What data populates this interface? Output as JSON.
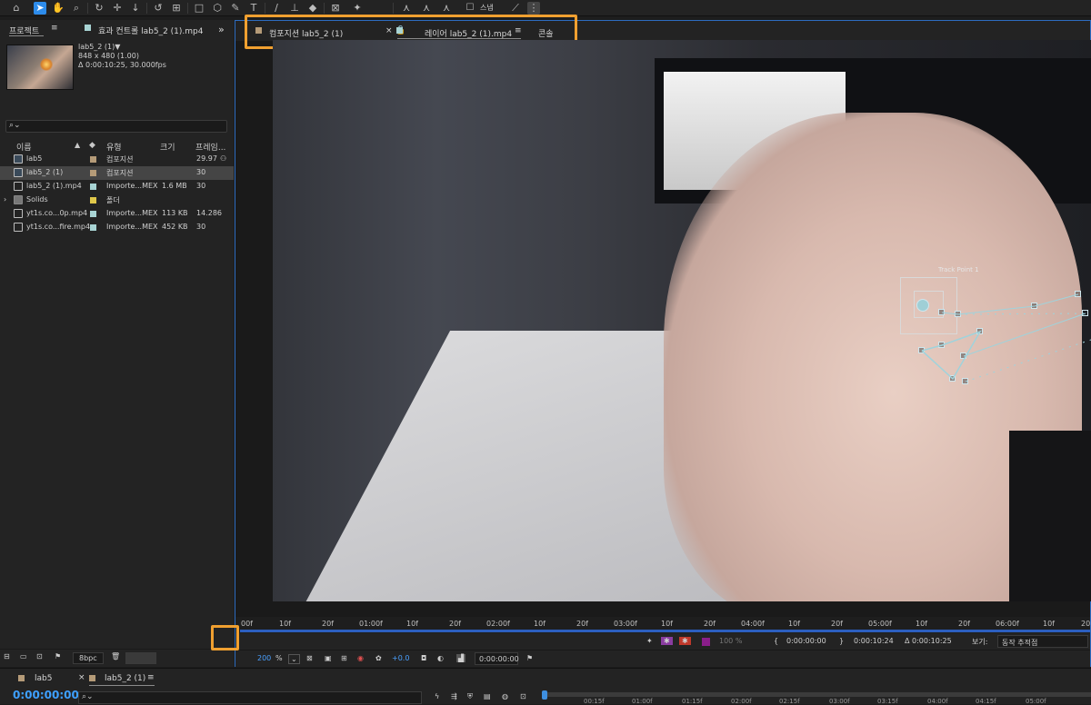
{
  "toolbar": {
    "snap_label": "스냅"
  },
  "project_panel": {
    "tab_project": "프로젝트",
    "tab_effects": "효과 컨트롤 lab5_2 (1).mp4",
    "item_name": "lab5_2 (1)▼",
    "item_dims": "848 x 480 (1.00)",
    "item_duration": "Δ 0:00:10:25, 30.000fps",
    "columns": {
      "name": "이름",
      "type": "유형",
      "size": "크기",
      "framerate": "프레임..."
    },
    "rows": [
      {
        "name": "lab5",
        "type": "컴포지션",
        "size": "",
        "fps": "29.97",
        "color": "#b59b78"
      },
      {
        "name": "lab5_2 (1)",
        "type": "컴포지션",
        "size": "",
        "fps": "30",
        "color": "#b59b78"
      },
      {
        "name": "lab5_2 (1).mp4",
        "type": "Importe...MEX",
        "size": "1.6 MB",
        "fps": "30",
        "color": "#a8d4d4"
      },
      {
        "name": "Solids",
        "type": "폴더",
        "size": "",
        "fps": "",
        "color": "#e0c84a"
      },
      {
        "name": "yt1s.co...0p.mp4",
        "type": "Importe...MEX",
        "size": "113 KB",
        "fps": "14.286",
        "color": "#a8d4d4"
      },
      {
        "name": "yt1s.co...fire.mp4",
        "type": "Importe...MEX",
        "size": "452 KB",
        "fps": "30",
        "color": "#a8d4d4"
      }
    ],
    "bpc": "8bpc"
  },
  "viewer": {
    "tab_comp": "컴포지션 lab5_2 (1)",
    "tab_layer": "레이어 lab5_2 (1).mp4",
    "tab_console": "콘솔",
    "track_point_label": "Track Point 1",
    "ruler_ticks": [
      "00f",
      "10f",
      "20f",
      "01:00f",
      "10f",
      "20f",
      "02:00f",
      "10f",
      "20f",
      "03:00f",
      "10f",
      "20f",
      "04:00f",
      "10f",
      "20f",
      "05:00f",
      "10f",
      "20f",
      "06:00f",
      "10f",
      "20"
    ],
    "opacity": "100 %",
    "in_time": "0:00:00:00",
    "out_time": "0:00:10:24",
    "duration": "Δ 0:00:10:25",
    "view_label": "보기:",
    "view_value": "동작 추적점",
    "zoom": "200",
    "zoom_unit": "%",
    "exposure": "+0.0",
    "current_time": "0:00:00:00"
  },
  "timeline": {
    "tab1": "lab5",
    "tab2": "lab5_2 (1)",
    "current_time": "0:00:00:00",
    "ticks": [
      "00:15f",
      "01:00f",
      "01:15f",
      "02:00f",
      "02:15f",
      "03:00f",
      "03:15f",
      "04:00f",
      "04:15f",
      "05:00f"
    ]
  },
  "colors": {
    "accent_blue": "#2d8ceb",
    "highlight_orange": "#f0a030",
    "time_blue": "#3ea0ff"
  }
}
